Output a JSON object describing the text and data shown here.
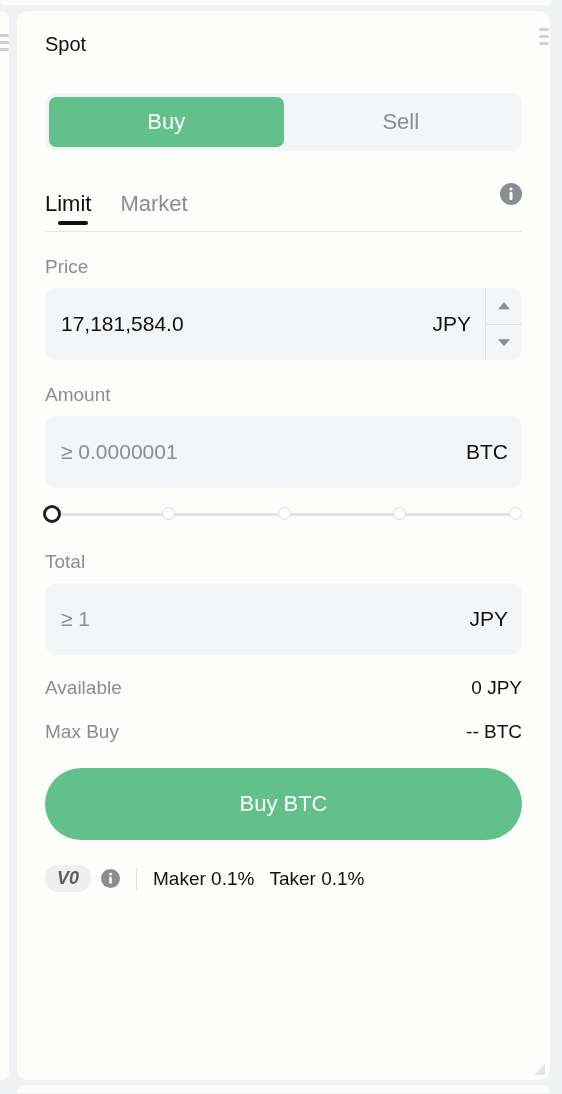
{
  "title": "Spot",
  "sides": [
    {
      "label": "Buy",
      "selected": true
    },
    {
      "label": "Sell",
      "selected": false
    }
  ],
  "order_types": [
    {
      "label": "Limit",
      "selected": true
    },
    {
      "label": "Market",
      "selected": false
    }
  ],
  "fields": [
    {
      "label": "Price",
      "value": "17,181,584.0",
      "unit": "JPY",
      "stepper": true
    },
    {
      "label": "Amount",
      "placeholder": "≥ 0.0000001",
      "unit": "BTC",
      "stepper": false,
      "slider": {
        "level": 0
      }
    },
    {
      "label": "Total",
      "placeholder": "≥ 1",
      "unit": "JPY",
      "stepper": false
    }
  ],
  "info_rows": [
    {
      "label": "Available",
      "value": "0 JPY"
    },
    {
      "label": "Max Buy",
      "value": "-- BTC"
    }
  ],
  "submit": "Buy BTC",
  "fees": {
    "tier": "V0",
    "maker": "Maker 0.1%",
    "taker": "Taker 0.1%"
  }
}
